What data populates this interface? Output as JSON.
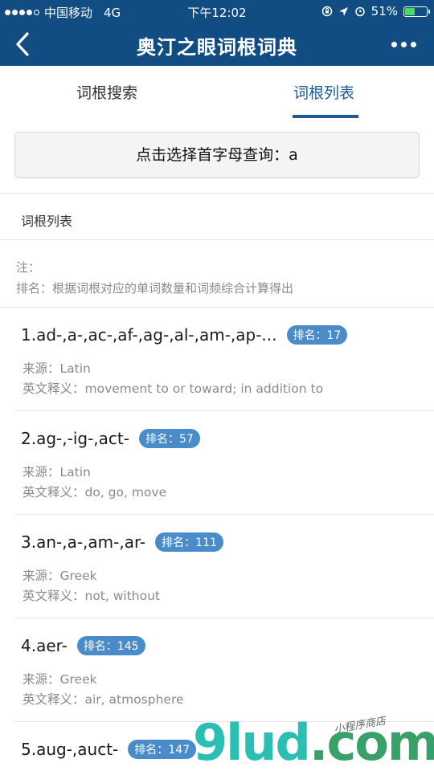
{
  "status": {
    "carrier": "中国移动",
    "network": "4G",
    "time": "下午12:02",
    "battery": "51%",
    "battery_fraction": 0.51
  },
  "navbar": {
    "title": "奥汀之眼词根词典"
  },
  "tabs": [
    {
      "label": "词根搜索"
    },
    {
      "label": "词根列表"
    }
  ],
  "select": {
    "label": "点击选择首字母查询：a"
  },
  "list": {
    "title": "词根列表",
    "note_line1": "注：",
    "note_line2": "排名：根据词根对应的单词数量和词频综合计算得出",
    "items": [
      {
        "name": "1.ad-,a-,ac-,af-,ag-,al-,am-,ap-...",
        "rank": "排名：17",
        "source": "来源：Latin",
        "meaning": "英文释义：movement to or toward; in addition to"
      },
      {
        "name": "2.ag-,-ig-,act-",
        "rank": "排名：57",
        "source": "来源：Latin",
        "meaning": "英文释义：do, go, move"
      },
      {
        "name": "3.an-,a-,am-,ar-",
        "rank": "排名：111",
        "source": "来源：Greek",
        "meaning": "英文释义：not, without"
      },
      {
        "name": "4.aer-",
        "rank": "排名：145",
        "source": "来源：Greek",
        "meaning": "英文释义：air, atmosphere"
      },
      {
        "name": "5.aug-,auct-",
        "rank": "排名：147",
        "source": "",
        "meaning": ""
      }
    ]
  },
  "watermark": {
    "main": "9lud",
    "suffix": ".com",
    "sub": "小程序商店"
  },
  "colors": {
    "primary": "#114d82",
    "tab_active": "#1c5b97",
    "badge": "#4a8bc9"
  }
}
